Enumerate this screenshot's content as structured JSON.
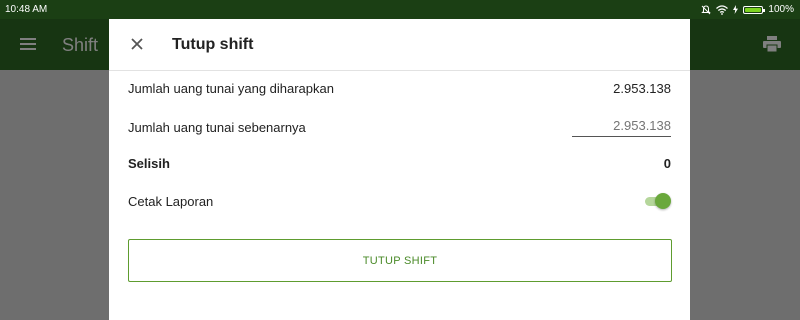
{
  "status_bar": {
    "time": "10:48 AM",
    "battery_percent": "100%",
    "battery_level": 1.0,
    "icons": [
      "notifications-off-icon",
      "wifi-icon",
      "charging-bolt-icon",
      "battery-icon"
    ]
  },
  "app_bar": {
    "title": "Shift",
    "icons": [
      "menu-icon",
      "print-icon"
    ]
  },
  "dialog": {
    "title": "Tutup shift",
    "expected_cash_label": "Jumlah uang tunai yang diharapkan",
    "expected_cash_value": "2.953.138",
    "actual_cash_label": "Jumlah uang tunai sebenarnya",
    "actual_cash_placeholder": "2.953.138",
    "actual_cash_value": "",
    "difference_label": "Selisih",
    "difference_value": "0",
    "print_report_label": "Cetak Laporan",
    "print_report_on": true,
    "submit_label": "TUTUP SHIFT"
  },
  "colors": {
    "status_bar": "#1b3f14",
    "app_bar": "#2f6a25",
    "accent": "#6aa83c",
    "button_text": "#4a8a28"
  }
}
